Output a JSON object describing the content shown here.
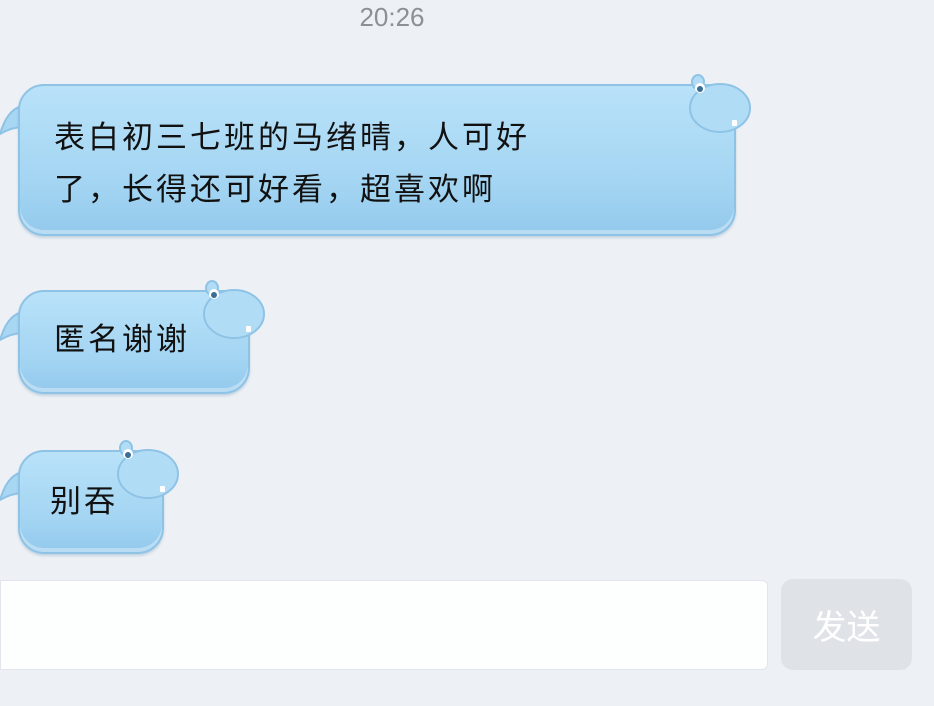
{
  "chat": {
    "timestamp": "20:26",
    "messages": [
      {
        "line1": "表白初三七班的马绪晴，人可好",
        "line2": "了，长得还可好看，超喜欢啊"
      },
      {
        "line1": "匿名谢谢"
      },
      {
        "line1": "别吞"
      }
    ]
  },
  "composer": {
    "input_value": "",
    "send_label": "发送"
  },
  "colors": {
    "background": "#edf0f5",
    "bubble": "#a9d8f4",
    "send_disabled": "#dfe2e7"
  },
  "icons": [
    "hippo-bubble-icon"
  ]
}
